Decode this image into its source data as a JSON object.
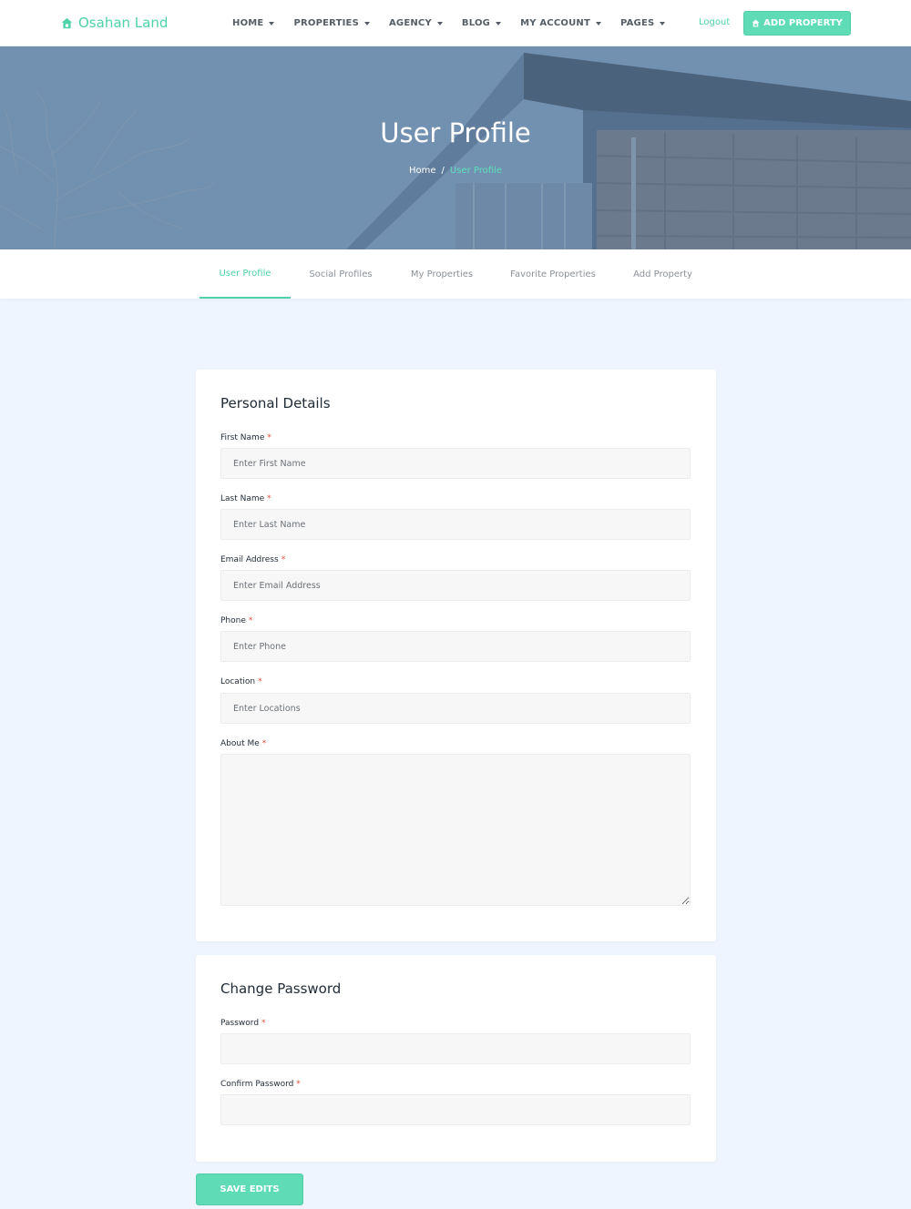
{
  "brand": {
    "name": "Osahan Land",
    "icon": "home-icon",
    "color": "#4fd1a9"
  },
  "nav": {
    "items": [
      {
        "label": "HOME"
      },
      {
        "label": "PROPERTIES"
      },
      {
        "label": "AGENCY"
      },
      {
        "label": "BLOG"
      },
      {
        "label": "MY ACCOUNT"
      },
      {
        "label": "PAGES"
      }
    ],
    "logout_label": "Logout",
    "add_property_label": "ADD PROPERTY"
  },
  "hero": {
    "title": "User Profile",
    "breadcrumb": {
      "home": "Home",
      "separator": "/",
      "current": "User Profile"
    }
  },
  "tabs": [
    {
      "label": "User Profile",
      "active": true
    },
    {
      "label": "Social Profiles",
      "active": false
    },
    {
      "label": "My Properties",
      "active": false
    },
    {
      "label": "Favorite Properties",
      "active": false
    },
    {
      "label": "Add Property",
      "active": false
    }
  ],
  "personal": {
    "title": "Personal Details",
    "required_marker": "*",
    "fields": [
      {
        "label": "First Name",
        "placeholder": "Enter First Name",
        "value": ""
      },
      {
        "label": "Last Name",
        "placeholder": "Enter Last Name",
        "value": ""
      },
      {
        "label": "Email Address",
        "placeholder": "Enter Email Address",
        "value": ""
      },
      {
        "label": "Phone",
        "placeholder": "Enter Phone",
        "value": ""
      },
      {
        "label": "Location",
        "placeholder": "Enter Locations",
        "value": ""
      },
      {
        "label": "About Me",
        "placeholder": "",
        "value": ""
      }
    ]
  },
  "password": {
    "title": "Change Password",
    "required_marker": "*",
    "fields": [
      {
        "label": "Password",
        "placeholder": "",
        "value": ""
      },
      {
        "label": "Confirm Password",
        "placeholder": "",
        "value": ""
      }
    ]
  },
  "save_label": "SAVE EDITS",
  "colors": {
    "accent": "#4fd1a9",
    "button": "#5fdcb6",
    "required": "#e74c3c",
    "page_bg": "#eff5ff"
  }
}
